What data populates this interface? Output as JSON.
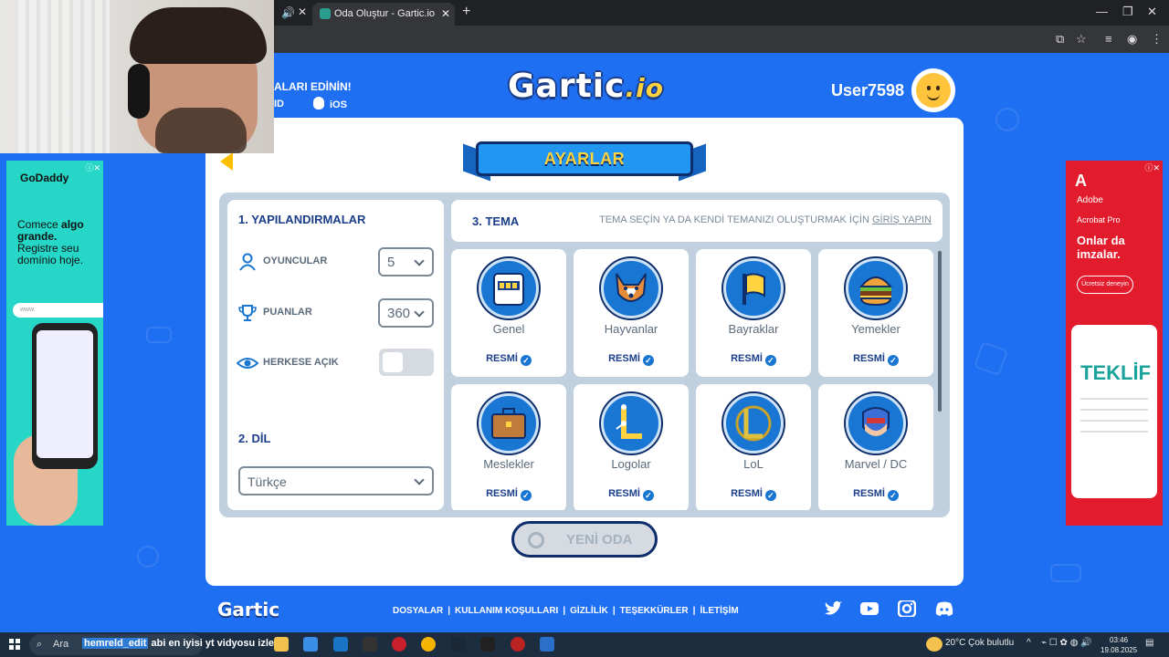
{
  "browser": {
    "inactive_tab": {
      "close": "✕"
    },
    "active_tab": {
      "title": "Oda Oluştur - Gartic.io",
      "close": "✕"
    },
    "new_tab": "+",
    "window_controls": [
      "—",
      "❐",
      "✕"
    ]
  },
  "header": {
    "promo_title": "ALARI EDİNİN!",
    "promo_android": "ID",
    "promo_ios": "iOS",
    "logo_main": "Gartic",
    "logo_suffix": ".io",
    "username": "User7598"
  },
  "settings": {
    "banner": "AYARLAR",
    "config_title": "1. YAPILANDIRMALAR",
    "players": {
      "label": "OYUNCULAR",
      "value": "5"
    },
    "points": {
      "label": "PUANLAR",
      "value": "360"
    },
    "public": {
      "label": "HERKESE AÇIK",
      "enabled": false
    },
    "language_title": "2. DİL",
    "language_value": "Türkçe",
    "theme_title": "3. TEMA",
    "theme_hint": "TEMA SEÇİN YA DA KENDİ TEMANIZI OLUŞTURMAK İÇİN",
    "theme_hint_link": "GİRİŞ YAPIN",
    "official_label": "RESMİ",
    "themes": [
      {
        "name": "Genel",
        "icon": "slot-machine-icon"
      },
      {
        "name": "Hayvanlar",
        "icon": "dog-icon"
      },
      {
        "name": "Bayraklar",
        "icon": "flag-icon"
      },
      {
        "name": "Yemekler",
        "icon": "burger-icon"
      },
      {
        "name": "Meslekler",
        "icon": "briefcase-icon"
      },
      {
        "name": "Logolar",
        "icon": "logo-l-icon"
      },
      {
        "name": "LoL",
        "icon": "lol-icon"
      },
      {
        "name": "Marvel / DC",
        "icon": "superhero-icon"
      }
    ],
    "new_room": "YENİ ODA"
  },
  "footer": {
    "logo": "Gartic",
    "links": [
      "DOSYALAR",
      "KULLANIM KOŞULLARI",
      "GİZLİLİK",
      "TEŞEKKÜRLER",
      "İLETİŞİM"
    ],
    "social_icons": [
      "twitter-icon",
      "youtube-icon",
      "instagram-icon",
      "discord-icon"
    ]
  },
  "ads": {
    "left": {
      "brand": "GoDaddy",
      "copy_1": "Comece ",
      "copy_bold": "algo grande.",
      "copy_2": " Registre seu domínio hoje.",
      "bar": "www."
    },
    "right": {
      "brand": "Adobe",
      "product": "Acrobat Pro",
      "copy": "Onlar da imzalar.",
      "cta": "Ücretsiz deneyin",
      "doc_title": "TEKLİF"
    }
  },
  "taskbar": {
    "search": "Ara",
    "overlay_user": "hemreld_edit",
    "overlay_text": " abi en iyisi yt vidyosu izle",
    "weather": "20°C  Çok bulutlu",
    "time": "03:46",
    "date": "19.08.2025"
  },
  "colors": {
    "page_bg": "#1f6ff2",
    "navy": "#1b3e8a",
    "accent_yellow": "#ffd23f"
  }
}
